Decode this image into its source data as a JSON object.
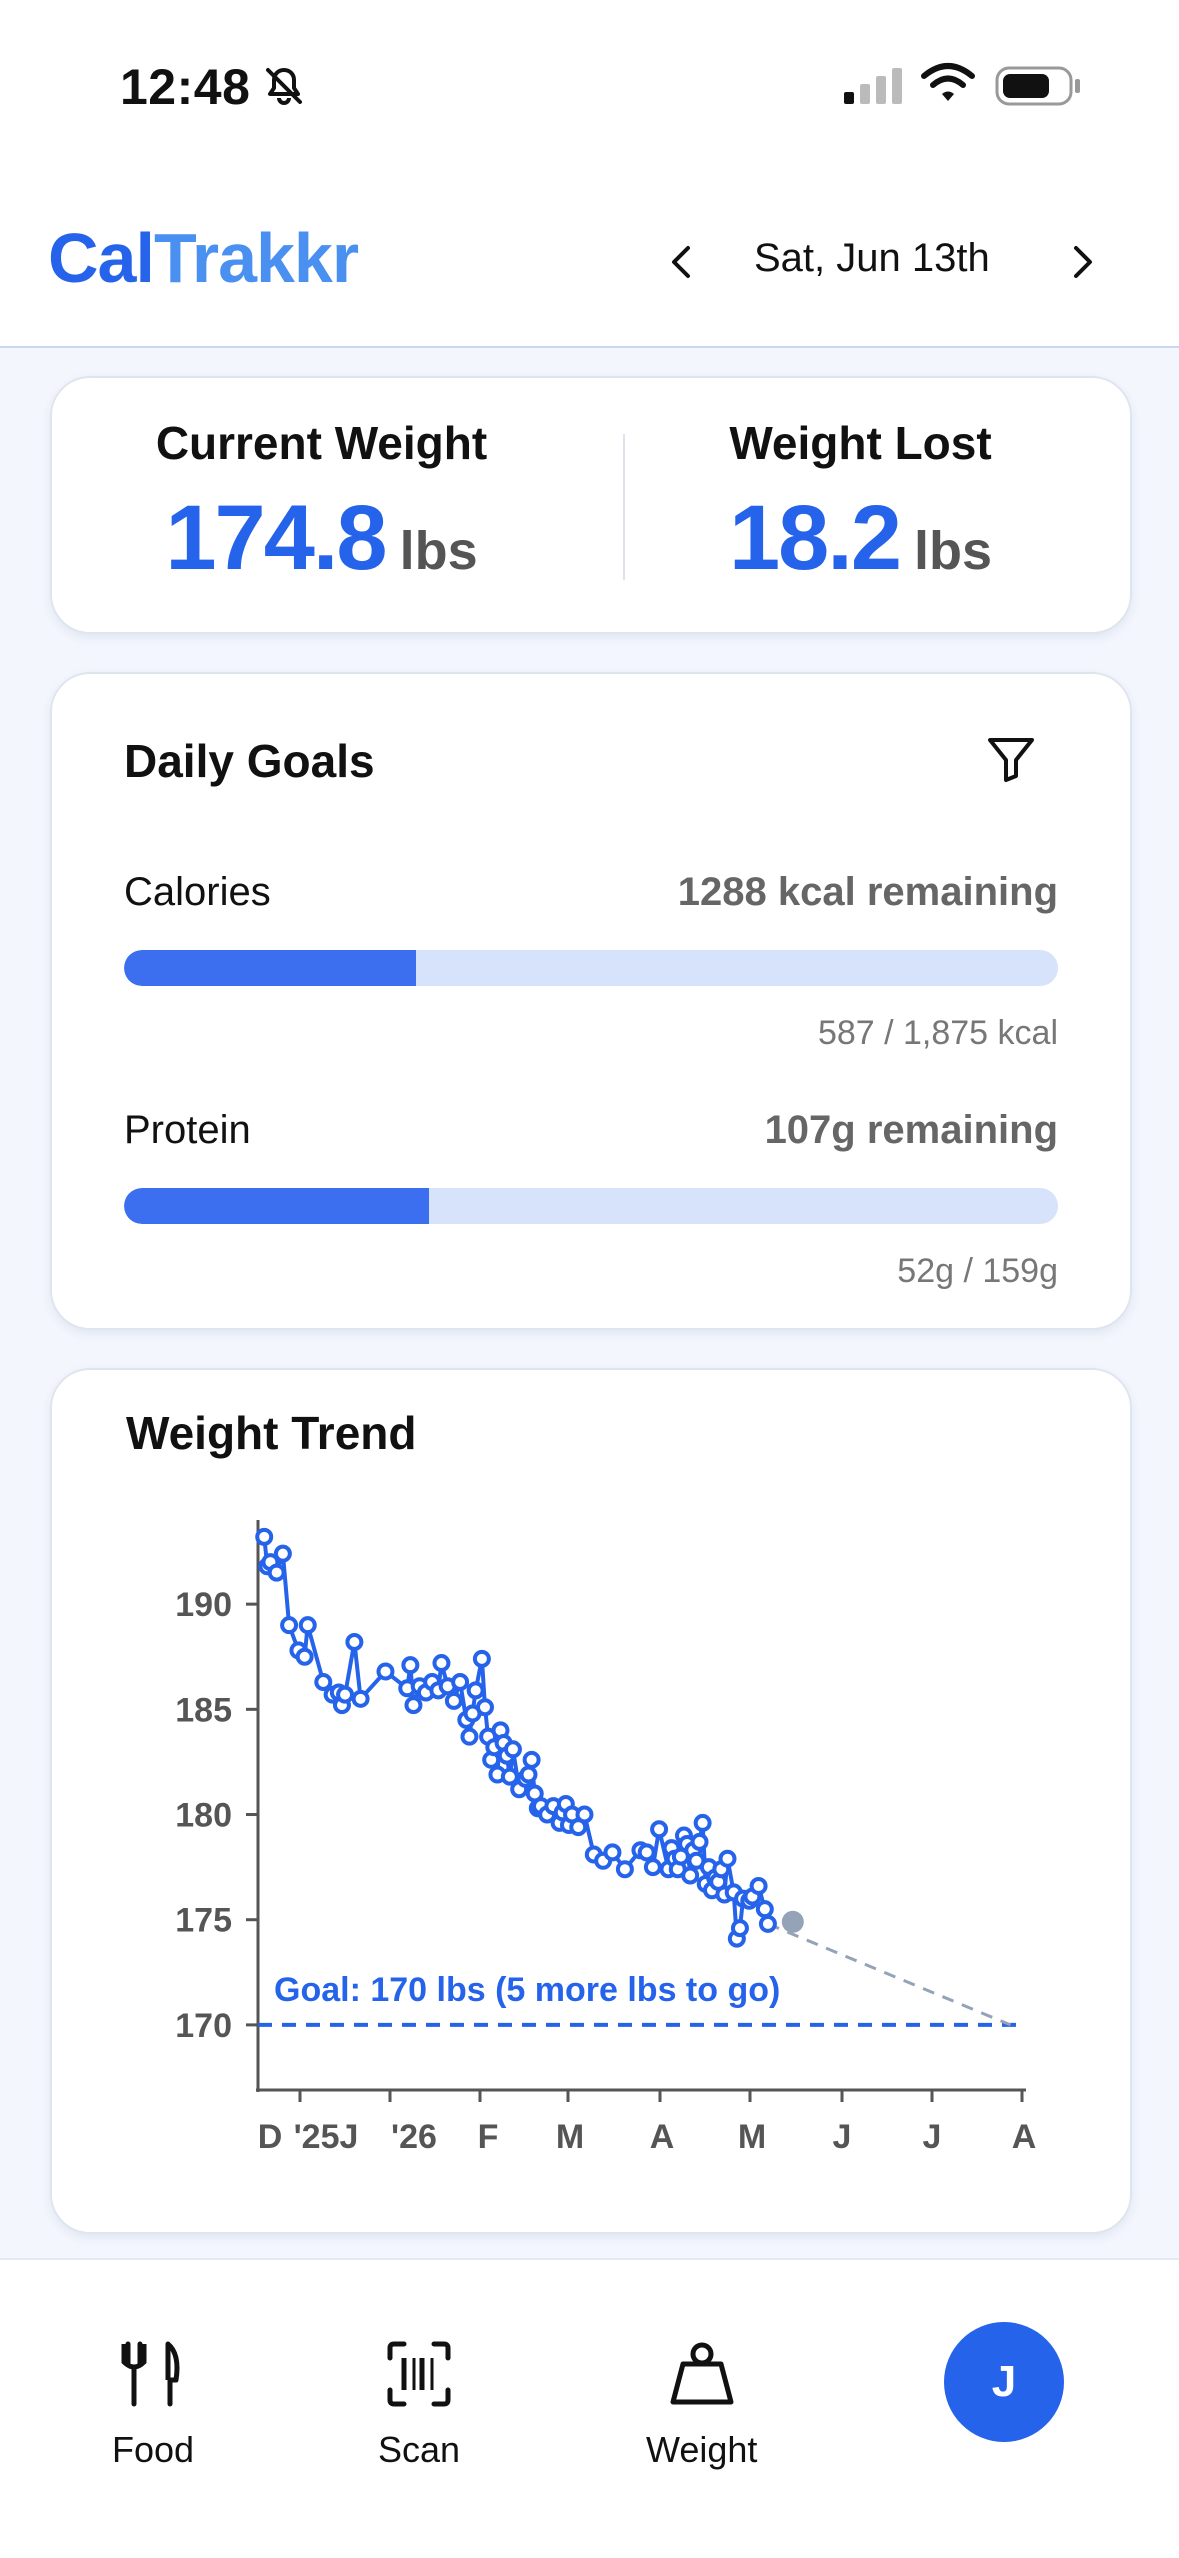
{
  "status_bar": {
    "time": "12:48"
  },
  "header": {
    "brand_part1": "Cal",
    "brand_part2": "Trakkr",
    "date": "Sat, Jun 13th"
  },
  "stats": {
    "current_weight": {
      "label": "Current Weight",
      "value": "174.8",
      "unit": "lbs"
    },
    "weight_lost": {
      "label": "Weight Lost",
      "value": "18.2",
      "unit": "lbs"
    }
  },
  "daily_goals": {
    "title": "Daily Goals",
    "calories": {
      "label": "Calories",
      "remaining": "1288 kcal remaining",
      "detail": "587 / 1,875 kcal",
      "progress": 0.313
    },
    "protein": {
      "label": "Protein",
      "remaining": "107g remaining",
      "detail": "52g / 159g",
      "progress": 0.327
    }
  },
  "weight_trend": {
    "title": "Weight Trend",
    "goal_label": "Goal: 170 lbs (5 more lbs to go)"
  },
  "chart_data": {
    "type": "line",
    "title": "Weight Trend",
    "x_tick_labels": [
      "D",
      "'25J",
      "'26",
      "F",
      "M",
      "A",
      "M",
      "J",
      "J",
      "A"
    ],
    "y_ticks": [
      170,
      175,
      180,
      185,
      190
    ],
    "ylim": [
      167,
      194
    ],
    "x_unit": "days since Dec 1, 2025",
    "xlim": [
      -2,
      245
    ],
    "series": [
      {
        "x": [
          0,
          1,
          2,
          4,
          6,
          8,
          11,
          13,
          14,
          19,
          22,
          24,
          25,
          26,
          29,
          31,
          39,
          46,
          47,
          48,
          50,
          52,
          54,
          56,
          57,
          59,
          61,
          63,
          65,
          66,
          67,
          68,
          70,
          71,
          72,
          73,
          74,
          75,
          76,
          77,
          78,
          79,
          80,
          82,
          84,
          85,
          86,
          87,
          88,
          89,
          91,
          93,
          95,
          96,
          97,
          98,
          99,
          101,
          103,
          106,
          109,
          112,
          116,
          121,
          123,
          125,
          127,
          130,
          131,
          132,
          133,
          134,
          135,
          136,
          137,
          138,
          139,
          140,
          141,
          142,
          143,
          144,
          145,
          146,
          147,
          148,
          149,
          151,
          152,
          153,
          154,
          156,
          157,
          159,
          161,
          162
        ],
        "y": [
          193.2,
          191.8,
          192.0,
          191.5,
          192.4,
          189.0,
          187.8,
          187.5,
          189.0,
          186.3,
          185.7,
          185.8,
          185.2,
          185.7,
          188.2,
          185.5,
          186.8,
          186.0,
          187.1,
          185.2,
          186.1,
          185.8,
          186.3,
          185.9,
          187.2,
          186.1,
          185.4,
          186.3,
          184.5,
          183.7,
          184.8,
          185.9,
          187.4,
          185.1,
          183.7,
          182.6,
          183.2,
          181.9,
          184.0,
          183.4,
          182.8,
          181.8,
          183.1,
          181.2,
          181.7,
          181.9,
          182.6,
          181.0,
          180.3,
          180.4,
          180.0,
          180.4,
          179.6,
          180.1,
          180.5,
          179.5,
          180.0,
          179.4,
          180.0,
          178.1,
          177.8,
          178.2,
          177.4,
          178.3,
          178.2,
          177.5,
          179.3,
          177.4,
          178.4,
          177.9,
          177.4,
          178.0,
          179.0,
          178.6,
          177.1,
          178.3,
          177.8,
          178.7,
          179.6,
          176.7,
          177.5,
          176.4,
          177.0,
          176.8,
          177.4,
          176.2,
          177.9,
          176.3,
          174.1,
          174.6,
          176.0,
          175.9,
          176.1,
          176.6,
          175.5,
          174.8
        ]
      }
    ],
    "projection": {
      "from": [
        162,
        174.8
      ],
      "to": [
        240,
        170.0
      ]
    },
    "goal_line": 170
  },
  "bottom_nav": {
    "food_label": "Food",
    "scan_label": "Scan",
    "weight_label": "Weight",
    "avatar_initial": "J"
  },
  "colors": {
    "accent": "#2563eb",
    "accent_light": "#4a90f0",
    "bar_track": "#d7e2fb",
    "projection": "#94a3b8"
  }
}
